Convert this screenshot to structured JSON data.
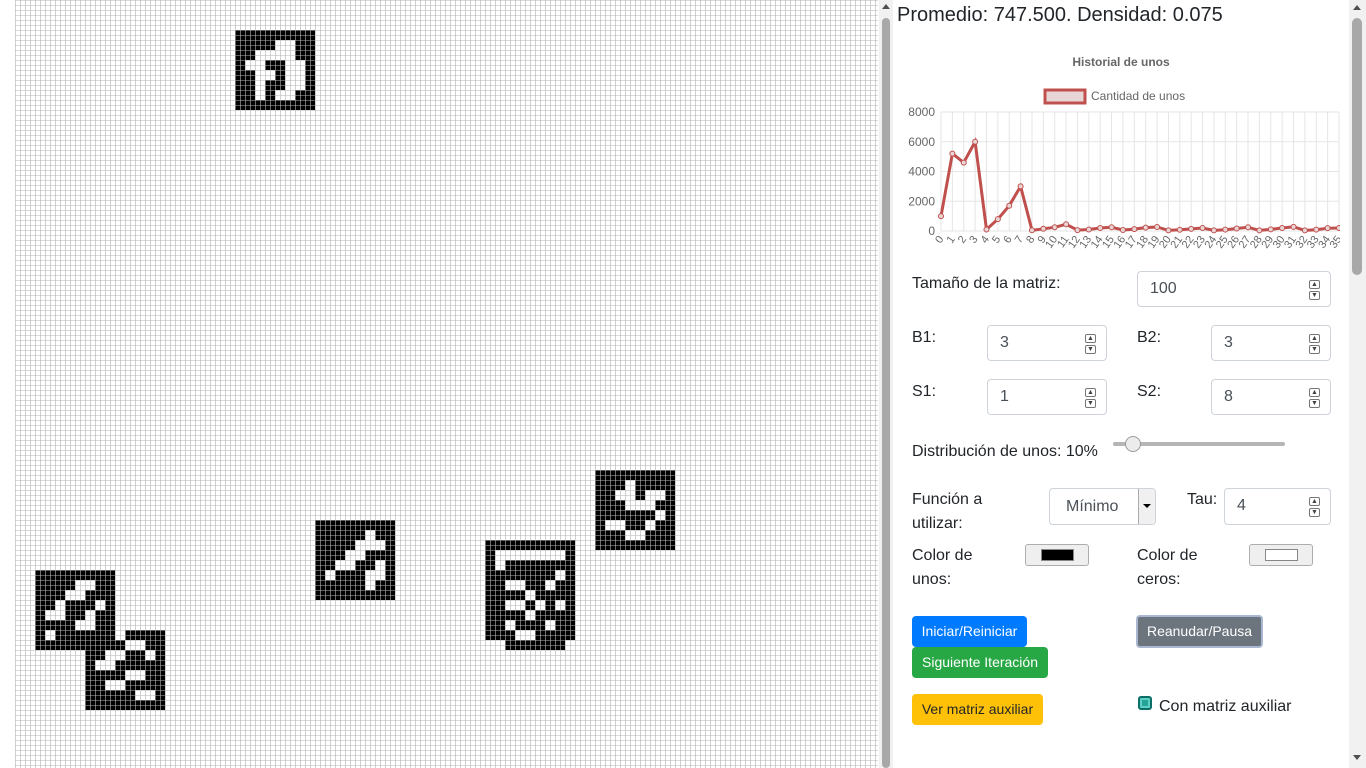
{
  "stats": {
    "text": "Promedio: 747.500. Densidad: 0.075"
  },
  "grid": {
    "size": 100,
    "cell_color": "#000000",
    "background": "#ffffff",
    "line_color": "#b3b3b3",
    "rows": [
      {
        "r": 3,
        "c": [
          22,
          23,
          24,
          25,
          26,
          27,
          28,
          29
        ]
      },
      {
        "r": 4,
        "c": [
          22,
          23,
          24,
          25,
          26,
          27,
          28,
          29
        ]
      },
      {
        "r": 5,
        "c": [
          22,
          23,
          24,
          25,
          26,
          27,
          28,
          29
        ]
      },
      {
        "r": 6,
        "c": [
          22,
          23,
          24,
          25,
          26,
          27,
          28,
          29
        ]
      },
      {
        "r": 7,
        "c": [
          22,
          23,
          24,
          25,
          26,
          27,
          28,
          29
        ]
      },
      {
        "r": 8,
        "c": [
          22,
          23,
          24,
          25,
          26,
          27,
          28,
          29
        ]
      },
      {
        "r": 9,
        "c": [
          22,
          23,
          24,
          25,
          26,
          27,
          28,
          29
        ]
      },
      {
        "r": 10,
        "c": [
          22,
          23,
          24,
          25,
          26,
          27,
          28,
          29
        ]
      }
    ],
    "holes": [
      {
        "r": 4,
        "c": [
          26,
          27
        ]
      },
      {
        "r": 5,
        "c": [
          24,
          25,
          26,
          27
        ]
      },
      {
        "r": 6,
        "c": [
          23,
          24,
          27,
          28
        ]
      },
      {
        "r": 7,
        "c": [
          24,
          25,
          27,
          28
        ]
      },
      {
        "r": 8,
        "c": [
          24,
          27,
          28
        ]
      },
      {
        "r": 9,
        "c": [
          24,
          26,
          27
        ]
      }
    ],
    "blocks": [
      {
        "r0": 52,
        "c0": 30,
        "h": 8,
        "w": 8,
        "holes": [
          [
            1,
            5
          ],
          [
            2,
            4
          ],
          [
            2,
            5
          ],
          [
            2,
            6
          ],
          [
            3,
            3
          ],
          [
            3,
            4
          ],
          [
            4,
            2
          ],
          [
            4,
            3
          ],
          [
            4,
            6
          ],
          [
            5,
            1
          ],
          [
            5,
            5
          ],
          [
            5,
            6
          ],
          [
            6,
            5
          ]
        ]
      },
      {
        "r0": 47,
        "c0": 58,
        "h": 8,
        "w": 8,
        "holes": [
          [
            1,
            3
          ],
          [
            2,
            2
          ],
          [
            2,
            3
          ],
          [
            2,
            5
          ],
          [
            2,
            6
          ],
          [
            3,
            3
          ],
          [
            3,
            4
          ],
          [
            3,
            5
          ],
          [
            4,
            6
          ],
          [
            5,
            1
          ],
          [
            5,
            2
          ],
          [
            5,
            5
          ],
          [
            6,
            3
          ],
          [
            6,
            4
          ]
        ]
      },
      {
        "r0": 54,
        "c0": 47,
        "h": 11,
        "w": 9,
        "holes": [
          [
            1,
            1
          ],
          [
            1,
            2
          ],
          [
            1,
            3
          ],
          [
            1,
            4
          ],
          [
            1,
            5
          ],
          [
            1,
            6
          ],
          [
            1,
            7
          ],
          [
            2,
            1
          ],
          [
            3,
            7
          ],
          [
            4,
            2
          ],
          [
            4,
            3
          ],
          [
            4,
            6
          ],
          [
            5,
            4
          ],
          [
            6,
            2
          ],
          [
            6,
            3
          ],
          [
            6,
            5
          ],
          [
            6,
            7
          ],
          [
            7,
            4
          ],
          [
            8,
            2
          ],
          [
            8,
            6
          ],
          [
            9,
            3
          ],
          [
            9,
            4
          ],
          [
            10,
            0
          ],
          [
            10,
            1
          ],
          [
            10,
            8
          ]
        ]
      },
      {
        "r0": 57,
        "c0": 2,
        "h": 8,
        "w": 8,
        "holes": [
          [
            1,
            4
          ],
          [
            1,
            5
          ],
          [
            2,
            3
          ],
          [
            2,
            4
          ],
          [
            3,
            2
          ],
          [
            3,
            6
          ],
          [
            4,
            1
          ],
          [
            4,
            2
          ],
          [
            4,
            5
          ],
          [
            5,
            4
          ],
          [
            5,
            5
          ],
          [
            6,
            1
          ]
        ]
      },
      {
        "r0": 63,
        "c0": 7,
        "h": 8,
        "w": 8,
        "holes": [
          [
            0,
            0
          ],
          [
            0,
            1
          ],
          [
            0,
            2
          ],
          [
            0,
            3
          ],
          [
            1,
            4
          ],
          [
            1,
            5
          ],
          [
            2,
            2
          ],
          [
            2,
            3
          ],
          [
            2,
            6
          ],
          [
            3,
            1
          ],
          [
            3,
            2
          ],
          [
            4,
            4
          ],
          [
            4,
            5
          ],
          [
            5,
            2
          ],
          [
            5,
            3
          ],
          [
            6,
            5
          ],
          [
            6,
            6
          ]
        ]
      }
    ]
  },
  "chart": {
    "title": "Historial de unos",
    "legend": "Cantidad de unos",
    "line_color": "#c0504d",
    "fill_color": "#e8d6d6",
    "y_ticks": [
      "0",
      "2000",
      "4000",
      "6000",
      "8000"
    ],
    "x_ticks": [
      "0",
      "1",
      "2",
      "3",
      "4",
      "5",
      "6",
      "7",
      "8",
      "9",
      "10",
      "11",
      "12",
      "13",
      "14",
      "15",
      "16",
      "17",
      "18",
      "19",
      "20",
      "21",
      "22",
      "23",
      "24",
      "25",
      "26",
      "27",
      "28",
      "29",
      "30",
      "31",
      "32",
      "33",
      "34",
      "35"
    ]
  },
  "chart_data": {
    "type": "line",
    "title": "Historial de unos",
    "xlabel": "",
    "ylabel": "",
    "ylim": [
      0,
      8000
    ],
    "x": [
      0,
      1,
      2,
      3,
      4,
      5,
      6,
      7,
      8,
      9,
      10,
      11,
      12,
      13,
      14,
      15,
      16,
      17,
      18,
      19,
      20,
      21,
      22,
      23,
      24,
      25,
      26,
      27,
      28,
      29,
      30,
      31,
      32,
      33,
      34,
      35
    ],
    "series": [
      {
        "name": "Cantidad de unos",
        "values": [
          1000,
          5200,
          4600,
          6000,
          100,
          800,
          1700,
          3000,
          50,
          150,
          250,
          450,
          60,
          100,
          200,
          250,
          70,
          130,
          230,
          270,
          40,
          80,
          140,
          200,
          40,
          90,
          170,
          250,
          40,
          110,
          200,
          280,
          40,
          90,
          190,
          200
        ]
      }
    ],
    "legend_position": "top",
    "grid": true
  },
  "controls": {
    "matrix_size_label": "Tamaño de la matriz:",
    "matrix_size_value": "100",
    "b1_label": "B1:",
    "b1_value": "3",
    "b2_label": "B2:",
    "b2_value": "3",
    "s1_label": "S1:",
    "s1_value": "1",
    "s2_label": "S2:",
    "s2_value": "8",
    "distribution_label": "Distribución de unos: 10%",
    "distribution_value": 0.1,
    "function_label_1": "Función a",
    "function_label_2": "utilizar:",
    "function_value": "Mínimo",
    "tau_label": "Tau:",
    "tau_value": "4",
    "ones_color_label_1": "Color de",
    "ones_color_label_2": "unos:",
    "ones_color": "#000000",
    "zeros_color_label_1": "Color de",
    "zeros_color_label_2": "ceros:",
    "zeros_color": "#ffffff"
  },
  "buttons": {
    "start": "Iniciar/Reiniciar",
    "pause": "Reanudar/Pausa",
    "next": "Siguiente Iteración",
    "aux": "Ver matriz auxiliar",
    "aux_check_label": "Con matriz auxiliar"
  }
}
